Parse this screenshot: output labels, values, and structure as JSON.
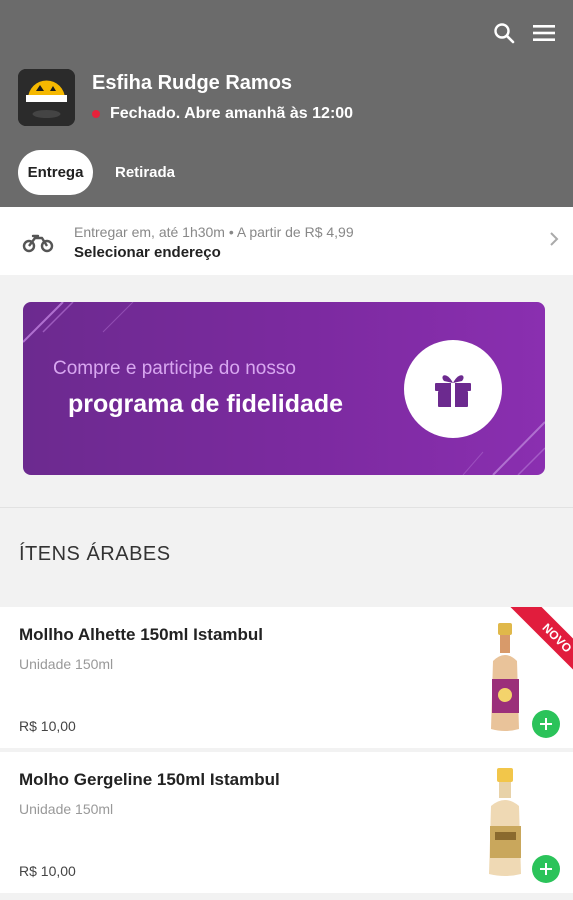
{
  "header": {
    "store_name": "Esfiha Rudge Ramos",
    "status_text": "Fechado. Abre amanhã às 12:00",
    "icons": [
      "search-icon",
      "menu-icon"
    ],
    "tabs": [
      {
        "label": "Entrega",
        "active": true
      },
      {
        "label": "Retirada",
        "active": false
      }
    ]
  },
  "delivery": {
    "info": "Entregar em, até 1h30m • A partir de R$ 4,99",
    "action": "Selecionar endereço"
  },
  "banner": {
    "line1": "Compre e participe do nosso",
    "line2": "programa de fidelidade"
  },
  "section": {
    "title": "ÍTENS ÁRABES"
  },
  "products": [
    {
      "name": "Mollho Alhette 150ml Istambul",
      "unit": "Unidade 150ml",
      "price": "R$ 10,00",
      "badge": "NOVO"
    },
    {
      "name": "Molho Gergeline 150ml Istambul",
      "unit": "Unidade 150ml",
      "price": "R$ 10,00"
    }
  ],
  "colors": {
    "header_bg": "#6b6b6b",
    "status_dot": "#e6223a",
    "banner_purple": "#7c2aa0",
    "add_green": "#2bc35a",
    "novo_red": "#e11d3d"
  }
}
